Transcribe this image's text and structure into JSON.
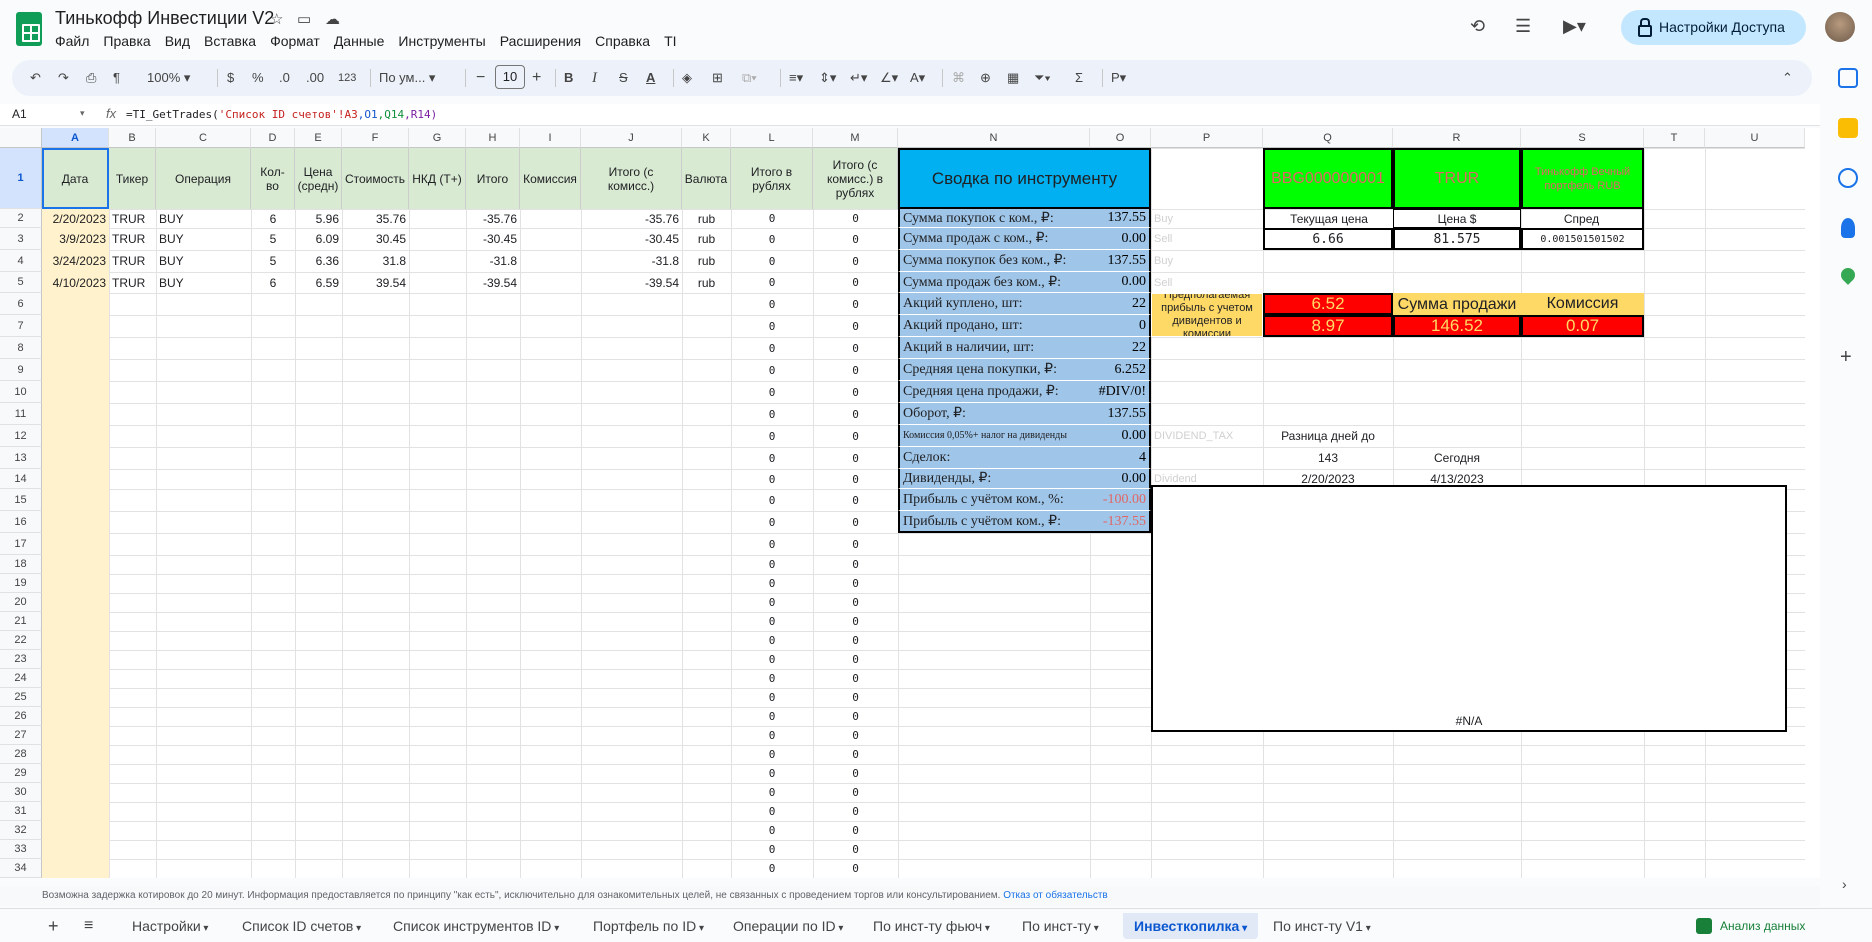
{
  "app": {
    "title": "Тинькофф Инвестиции V2",
    "menus": [
      "Файл",
      "Правка",
      "Вид",
      "Вставка",
      "Формат",
      "Данные",
      "Инструменты",
      "Расширения",
      "Справка",
      "TI"
    ],
    "share_label": "Настройки Доступа"
  },
  "toolbar": {
    "zoom": "100%",
    "currency": "$",
    "percent": "%",
    "dec_less": ".0",
    "dec_more": ".00",
    "format_123": "123",
    "font": "По ум...",
    "font_size": "10",
    "bold": "B",
    "italic": "I",
    "strike": "S",
    "text_color": "A"
  },
  "formula_bar": {
    "cell_ref": "A1",
    "fx": "fx",
    "formula_prefix": "=TI_GetTrades(",
    "formula_str": "'Список ID счетов'!A3",
    "formula_r1": ",O1",
    "formula_r2": ",Q14",
    "formula_r3": ",R14)"
  },
  "columns": [
    "A",
    "B",
    "C",
    "D",
    "E",
    "F",
    "G",
    "H",
    "I",
    "J",
    "K",
    "L",
    "M",
    "N",
    "O",
    "P",
    "Q",
    "R",
    "S",
    "T",
    "U"
  ],
  "rows": [
    "1",
    "2",
    "3",
    "4",
    "5",
    "6",
    "7",
    "8",
    "9",
    "10",
    "11",
    "12",
    "13",
    "14",
    "15",
    "16",
    "17",
    "18",
    "19",
    "20",
    "21",
    "22",
    "23",
    "24",
    "25",
    "26",
    "27",
    "28",
    "29",
    "30",
    "31",
    "32",
    "33",
    "34"
  ],
  "headers": {
    "date": "Дата",
    "ticker": "Тикер",
    "operation": "Операция",
    "qty": "Кол-во",
    "price": "Цена (средн)",
    "cost": "Стоимость",
    "nkd": "НКД (Т+)",
    "total": "Итого",
    "commission": "Комиссия",
    "total_comm": "Итого (с комисс.)",
    "currency": "Валюта",
    "total_rub": "Итого в рублях",
    "total_comm_rub": "Итого (с комисс.) в рублях"
  },
  "trades": [
    {
      "date": "2/20/2023",
      "ticker": "TRUR",
      "op": "BUY",
      "qty": "6",
      "price": "5.96",
      "cost": "35.76",
      "total": "-35.76",
      "total_comm": "-35.76",
      "cur": "rub",
      "rub": "0",
      "rub_comm": "0"
    },
    {
      "date": "3/9/2023",
      "ticker": "TRUR",
      "op": "BUY",
      "qty": "5",
      "price": "6.09",
      "cost": "30.45",
      "total": "-30.45",
      "total_comm": "-30.45",
      "cur": "rub",
      "rub": "0",
      "rub_comm": "0"
    },
    {
      "date": "3/24/2023",
      "ticker": "TRUR",
      "op": "BUY",
      "qty": "5",
      "price": "6.36",
      "cost": "31.8",
      "total": "-31.8",
      "total_comm": "-31.8",
      "cur": "rub",
      "rub": "0",
      "rub_comm": "0"
    },
    {
      "date": "4/10/2023",
      "ticker": "TRUR",
      "op": "BUY",
      "qty": "6",
      "price": "6.59",
      "cost": "39.54",
      "total": "-39.54",
      "total_comm": "-39.54",
      "cur": "rub",
      "rub": "0",
      "rub_comm": "0"
    }
  ],
  "zero_value": "0",
  "summary": {
    "title": "Сводка по инструменту",
    "rows": [
      {
        "label": "Сумма покупок с ком., ₽:",
        "value": "137.55",
        "side": "Buy"
      },
      {
        "label": "Сумма продаж с ком., ₽:",
        "value": "0.00",
        "side": "Sell"
      },
      {
        "label": "Сумма покупок без ком., ₽:",
        "value": "137.55",
        "side": "Buy"
      },
      {
        "label": "Сумма продаж без ком., ₽:",
        "value": "0.00",
        "side": "Sell"
      },
      {
        "label": "Акций куплено, шт:",
        "value": "22",
        "side": ""
      },
      {
        "label": "Акций продано, шт:",
        "value": "0",
        "side": ""
      },
      {
        "label": "Акций в наличии, шт:",
        "value": "22",
        "side": ""
      },
      {
        "label": "Средняя цена покупки, ₽:",
        "value": "6.252",
        "side": ""
      },
      {
        "label": "Средняя цена продажи, ₽:",
        "value": "#DIV/0!",
        "side": ""
      },
      {
        "label": "Оборот, ₽:",
        "value": "137.55",
        "side": ""
      },
      {
        "label": "Комиссия 0,05%+ налог на дивиденды",
        "value": "0.00",
        "side": "DIVIDEND_TAX"
      },
      {
        "label": "Сделок:",
        "value": "4",
        "side": ""
      },
      {
        "label": "Дивиденды, ₽:",
        "value": "0.00",
        "side": "Dividend"
      },
      {
        "label": "Прибыль с учётом ком., %:",
        "value": "-100.00",
        "side": ""
      },
      {
        "label": "Прибыль с учётом ком., ₽:",
        "value": "-137.55",
        "side": ""
      }
    ]
  },
  "instrument": {
    "figi": "BBG000000001",
    "ticker": "TRUR",
    "name": "Тинькофф Вечный портфель RUB",
    "current_price_label": "Текущая цена",
    "current_price": "6.66",
    "price_usd_label": "Цена  $",
    "price_usd": "81.575",
    "spread_label": "Спред",
    "spread": "0.001501501502"
  },
  "profit": {
    "label": "Предполагаемая прибыль с учетом дивидентов и комиссии",
    "value1": "6.52",
    "value2": "8.97",
    "sale_label": "Сумма продажи",
    "sale_value": "146.52",
    "commission_label": "Комиссия",
    "commission_value": "0.07"
  },
  "dates": {
    "diff_label": "Разница дней до",
    "diff_value": "143",
    "today_label": "Сегодня",
    "start_date": "2/20/2023",
    "today_date": "4/13/2023"
  },
  "chart_placeholder": "#N/A",
  "footer": {
    "note": "Возможна задержка котировок до 20 минут. Информация предоставляется по принципу \"как есть\", исключительно для ознакомительных целей, не связанных с проведением торгов или консультированием.",
    "link": "Отказ от обязательств"
  },
  "sheets": [
    "Настройки",
    "Список ID счетов",
    "Список инструментов ID",
    "Портфель по ID",
    "Операции по ID",
    "По инст-ту фьюч",
    "По инст-ту",
    "Инвесткопилка",
    "По инст-ту V1"
  ],
  "active_sheet": "Инвесткопилка",
  "explore_label": "Анализ данных",
  "colors": {
    "header_green": "#d9ead3",
    "summary_blue": "#00b0f0",
    "summary_light": "#9fc5e8",
    "green": "#00ff00",
    "red": "#ff0000",
    "amber": "#ffd966",
    "yellow_col": "#fff2cc"
  }
}
